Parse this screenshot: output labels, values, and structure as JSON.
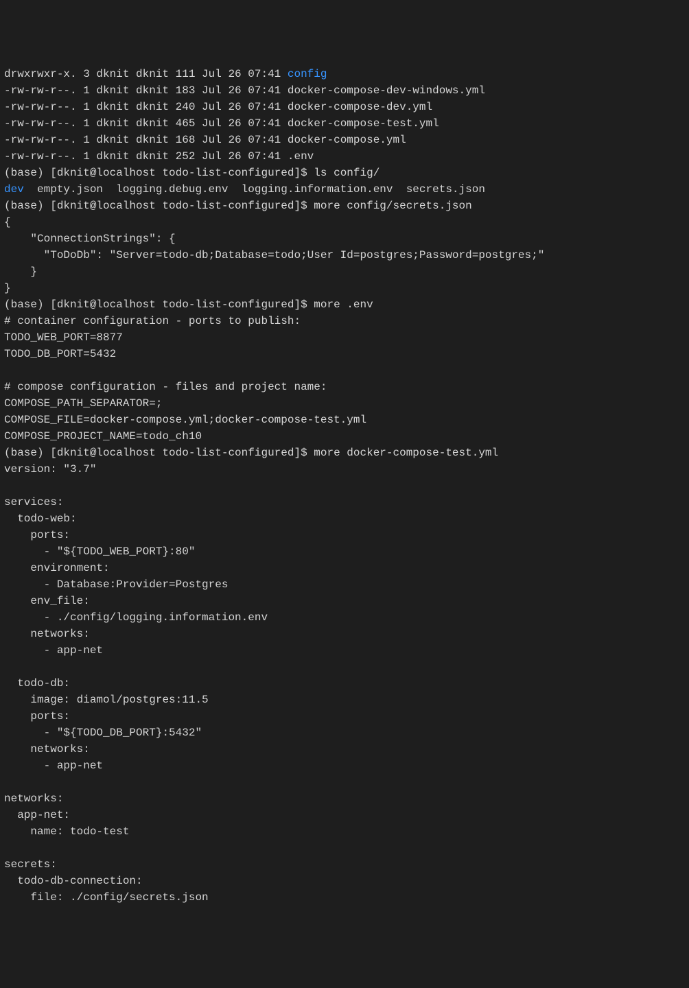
{
  "prompt": "(base) [dknit@localhost todo-list-configured]$ ",
  "ls_entries": [
    {
      "perm": "drwxrwxr-x.",
      "links": "3",
      "owner": "dknit",
      "group": "dknit",
      "size": "111",
      "date": "Jul 26 07:41",
      "name": "config",
      "is_dir": true
    },
    {
      "perm": "-rw-rw-r--.",
      "links": "1",
      "owner": "dknit",
      "group": "dknit",
      "size": "183",
      "date": "Jul 26 07:41",
      "name": "docker-compose-dev-windows.yml",
      "is_dir": false
    },
    {
      "perm": "-rw-rw-r--.",
      "links": "1",
      "owner": "dknit",
      "group": "dknit",
      "size": "240",
      "date": "Jul 26 07:41",
      "name": "docker-compose-dev.yml",
      "is_dir": false
    },
    {
      "perm": "-rw-rw-r--.",
      "links": "1",
      "owner": "dknit",
      "group": "dknit",
      "size": "465",
      "date": "Jul 26 07:41",
      "name": "docker-compose-test.yml",
      "is_dir": false
    },
    {
      "perm": "-rw-rw-r--.",
      "links": "1",
      "owner": "dknit",
      "group": "dknit",
      "size": "168",
      "date": "Jul 26 07:41",
      "name": "docker-compose.yml",
      "is_dir": false
    },
    {
      "perm": "-rw-rw-r--.",
      "links": "1",
      "owner": "dknit",
      "group": "dknit",
      "size": "252",
      "date": "Jul 26 07:41",
      "name": ".env",
      "is_dir": false
    }
  ],
  "cmd1": "ls config/",
  "ls_config": {
    "dir_entry": "dev",
    "rest": "  empty.json  logging.debug.env  logging.information.env  secrets.json"
  },
  "cmd2": "more config/secrets.json",
  "secrets_json": "{\n    \"ConnectionStrings\": {\n      \"ToDoDb\": \"Server=todo-db;Database=todo;User Id=postgres;Password=postgres;\"\n    }\n}",
  "cmd3": "more .env",
  "env_file": "# container configuration - ports to publish:\nTODO_WEB_PORT=8877\nTODO_DB_PORT=5432\n\n# compose configuration - files and project name:\nCOMPOSE_PATH_SEPARATOR=;\nCOMPOSE_FILE=docker-compose.yml;docker-compose-test.yml\nCOMPOSE_PROJECT_NAME=todo_ch10",
  "cmd4": "more docker-compose-test.yml",
  "compose_yml": "version: \"3.7\"\n\nservices:\n  todo-web:\n    ports:\n      - \"${TODO_WEB_PORT}:80\"\n    environment:\n      - Database:Provider=Postgres\n    env_file:\n      - ./config/logging.information.env\n    networks:\n      - app-net\n\n  todo-db:\n    image: diamol/postgres:11.5\n    ports:\n      - \"${TODO_DB_PORT}:5432\"\n    networks:\n      - app-net\n\nnetworks:\n  app-net:\n    name: todo-test\n\nsecrets:\n  todo-db-connection:\n    file: ./config/secrets.json"
}
